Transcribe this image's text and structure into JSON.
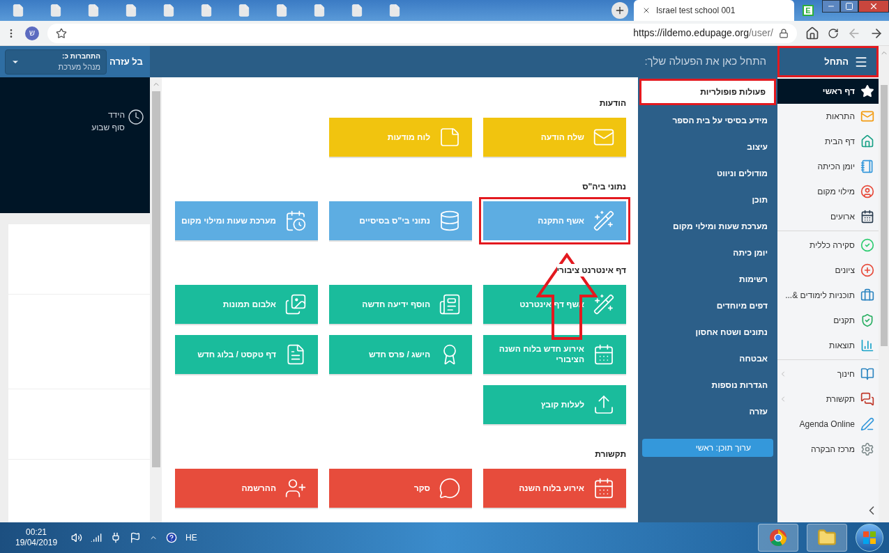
{
  "browser": {
    "tab_title": "Israel test school 001",
    "url_host": "https://ildemo.edupage.org",
    "url_path": "/user/",
    "profile_initial": "ש",
    "app_badge": "E"
  },
  "header": {
    "login_label": "התחברות כ:",
    "login_role": "מנהל מערכת",
    "help_label": "בל עזרה",
    "title": "התחל כאן את הפעולה שלך:",
    "start": {
      "label": "התחל",
      "annotated": true
    }
  },
  "left_panel": {
    "event_title": "הידד",
    "event_subtitle": "סוף שבוע"
  },
  "sections": [
    {
      "title": "הודעות",
      "color": "#f1c40f",
      "tiles": [
        {
          "label": "שלח הודעה",
          "annotated": false
        },
        {
          "label": "לוח מודעות",
          "annotated": false
        }
      ]
    },
    {
      "title": "נתוני ביה\"ס",
      "color": "#5dade2",
      "tiles": [
        {
          "label": "אשף התקנה",
          "annotated": true
        },
        {
          "label": "נתוני בי\"ס בסיסיים",
          "annotated": false
        },
        {
          "label": "מערכת שעות ומילוי מקום",
          "annotated": false
        }
      ]
    },
    {
      "title": "דף אינטרנט ציבורי",
      "color": "#1abc9c",
      "tiles": [
        {
          "label": "אשף דף אינטרנט",
          "annotated": false
        },
        {
          "label": "הוסף ידיעה חדשה",
          "annotated": false
        },
        {
          "label": "אלבום תמונות",
          "annotated": false
        },
        {
          "label": "אירוע חדש בלוח השנה הציבורי",
          "annotated": false
        },
        {
          "label": "הישג / פרס חדש",
          "annotated": false
        },
        {
          "label": "דף טקסט / בלוג חדש",
          "annotated": false
        },
        {
          "label": "לעלות קובץ",
          "annotated": false
        }
      ]
    },
    {
      "title": "תקשורת",
      "color": "#e74c3c",
      "tiles": [
        {
          "label": "אירוע בלוח השנה",
          "annotated": false
        },
        {
          "label": "סקר",
          "annotated": false
        },
        {
          "label": "ההרשמה",
          "annotated": false
        }
      ]
    }
  ],
  "menu": {
    "items": [
      {
        "label": "פעולות פופולריות",
        "selected": true,
        "annotated": true
      },
      {
        "label": "מידע בסיסי על בית הספר",
        "selected": false,
        "annotated": false
      },
      {
        "label": "עיצוב",
        "selected": false,
        "annotated": false
      },
      {
        "label": "מודולים וניווט",
        "selected": false,
        "annotated": false
      },
      {
        "label": "תוכן",
        "selected": false,
        "annotated": false
      },
      {
        "label": "מערכת שעות ומילוי מקום",
        "selected": false,
        "annotated": false
      },
      {
        "label": "יומן כיתה",
        "selected": false,
        "annotated": false
      },
      {
        "label": "רשימות",
        "selected": false,
        "annotated": false
      },
      {
        "label": "דפים מיוחדים",
        "selected": false,
        "annotated": false
      },
      {
        "label": "נתונים ושטח אחסון",
        "selected": false,
        "annotated": false
      },
      {
        "label": "אבטחה",
        "selected": false,
        "annotated": false
      },
      {
        "label": "הגדרות נוספות",
        "selected": false,
        "annotated": false
      },
      {
        "label": "עזרה",
        "selected": false,
        "annotated": false
      }
    ],
    "edit_button": "ערוך תוכן: ראשי"
  },
  "sidebar": {
    "groups": [
      {
        "items": [
          {
            "label": "דף ראשי",
            "selected": true,
            "has_submenu": false
          },
          {
            "label": "התראות",
            "selected": false,
            "has_submenu": false
          },
          {
            "label": "דף הבית",
            "selected": false,
            "has_submenu": false
          },
          {
            "label": "יומן הכיתה",
            "selected": false,
            "has_submenu": false
          },
          {
            "label": "מילוי מקום",
            "selected": false,
            "has_submenu": false
          },
          {
            "label": "ארועים",
            "selected": false,
            "has_submenu": false
          }
        ]
      },
      {
        "items": [
          {
            "label": "סקירה כללית",
            "selected": false,
            "has_submenu": false
          },
          {
            "label": "ציונים",
            "selected": false,
            "has_submenu": false
          },
          {
            "label": "תוכניות לימודים &...",
            "selected": false,
            "has_submenu": false
          },
          {
            "label": "תקנים",
            "selected": false,
            "has_submenu": false
          },
          {
            "label": "תוצאות",
            "selected": false,
            "has_submenu": false
          }
        ]
      },
      {
        "items": [
          {
            "label": "חינוך",
            "selected": false,
            "has_submenu": true
          },
          {
            "label": "תקשורת",
            "selected": false,
            "has_submenu": true
          },
          {
            "label": "Agenda Online",
            "selected": false,
            "has_submenu": false
          },
          {
            "label": "מרכז הבקרה",
            "selected": false,
            "has_submenu": false
          }
        ]
      }
    ]
  },
  "taskbar": {
    "time": "00:21",
    "date": "19/04/2019",
    "language": "HE"
  }
}
